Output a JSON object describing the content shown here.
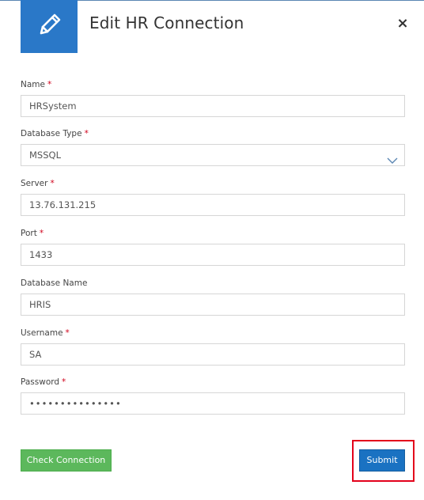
{
  "dialog": {
    "title": "Edit HR Connection",
    "close_label": "×",
    "header_icon": "pencil-icon"
  },
  "fields": {
    "name": {
      "label": "Name",
      "required": "*",
      "value": "HRSystem"
    },
    "database_type": {
      "label": "Database Type",
      "required": "*",
      "value": "MSSQL",
      "icon": "chevron-down-icon"
    },
    "server": {
      "label": "Server",
      "required": "*",
      "value": "13.76.131.215"
    },
    "port": {
      "label": "Port",
      "required": "*",
      "value": "1433"
    },
    "database_name": {
      "label": "Database Name",
      "value": "HRIS"
    },
    "username": {
      "label": "Username",
      "required": "*",
      "value": "SA"
    },
    "password": {
      "label": "Password",
      "required": "*",
      "value": "•••••••••••••••"
    }
  },
  "buttons": {
    "check_connection": "Check Connection",
    "submit": "Submit"
  },
  "colors": {
    "header_blue": "#2a78c8",
    "submit_blue": "#1a72c2",
    "check_green": "#5cb85c",
    "highlight_red": "#e3001b",
    "required_red": "#d0021b"
  }
}
